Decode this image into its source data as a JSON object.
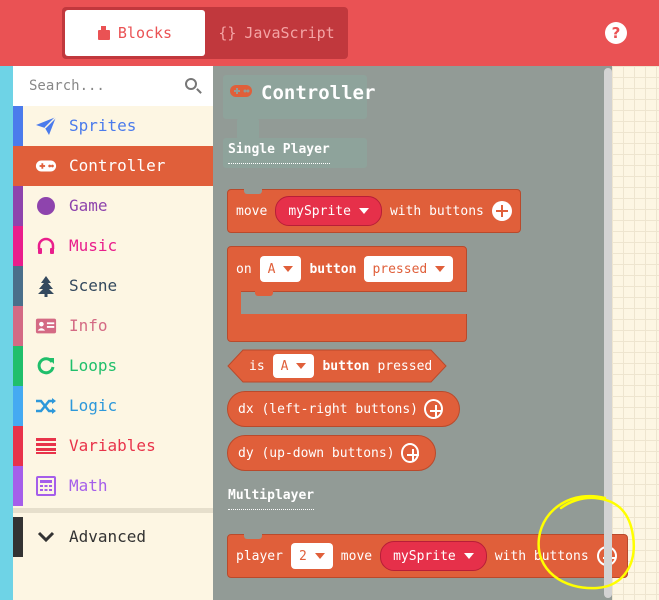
{
  "header": {
    "blocks_tab": "Blocks",
    "js_tab_brackets": "{}",
    "js_tab": "JavaScript",
    "help": "?"
  },
  "toolbox": {
    "search_placeholder": "Search...",
    "categories": [
      {
        "label": "Sprites",
        "color": "#4b7bec",
        "icon": "paper-plane-icon"
      },
      {
        "label": "Controller",
        "color": "#e05f3a",
        "icon": "gamepad-icon"
      },
      {
        "label": "Game",
        "color": "#8e44ad",
        "icon": "circle-icon"
      },
      {
        "label": "Music",
        "color": "#e91e8c",
        "icon": "headphones-icon"
      },
      {
        "label": "Scene",
        "color": "#4a6f8a",
        "icon": "tree-icon"
      },
      {
        "label": "Info",
        "color": "#d46a84",
        "icon": "id-card-icon"
      },
      {
        "label": "Loops",
        "color": "#20bf6b",
        "icon": "refresh-icon"
      },
      {
        "label": "Logic",
        "color": "#45aaf2",
        "icon": "shuffle-icon"
      },
      {
        "label": "Variables",
        "color": "#e8334a",
        "icon": "list-icon"
      },
      {
        "label": "Math",
        "color": "#a55eea",
        "icon": "calculator-icon"
      }
    ],
    "advanced": {
      "label": "Advanced",
      "color": "#333333",
      "icon": "chevron-down-icon"
    }
  },
  "flyout": {
    "title": "Controller",
    "single_player": "Single Player",
    "multiplayer": "Multiplayer",
    "move_block": {
      "move": "move",
      "sprite": "mySprite",
      "with_buttons": "with buttons"
    },
    "on_block": {
      "on": "on",
      "button_value": "A",
      "button": "button",
      "event": "pressed"
    },
    "is_block": {
      "is": "is",
      "button_value": "A",
      "button": "button",
      "pressed": "pressed"
    },
    "dx_block": {
      "label": "dx (left-right buttons)"
    },
    "dy_block": {
      "label": "dy (up-down buttons)"
    },
    "player_block": {
      "player": "player",
      "number": "2",
      "move": "move",
      "sprite": "mySprite",
      "with_buttons": "with buttons"
    }
  },
  "colors": {
    "header": "#ea5254",
    "controller": "#e05f3a",
    "sprite_pill": "#e6304a",
    "flyout_bg": "#929b96",
    "annotation": "#ffff00"
  }
}
